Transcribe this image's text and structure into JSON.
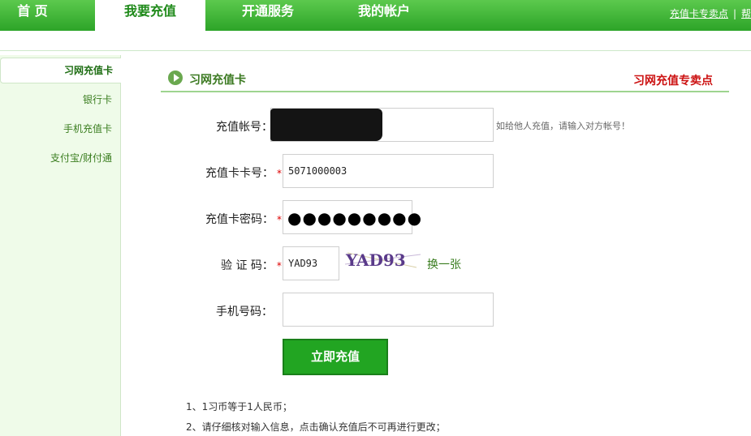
{
  "nav": {
    "items": [
      "首 页",
      "我要充值",
      "开通服务",
      "我的帐户"
    ],
    "links": {
      "sellers": "充值卡专卖点",
      "sep": "|",
      "help": "帮"
    }
  },
  "sidebar": {
    "items": [
      "习网充值卡",
      "银行卡",
      "手机充值卡",
      "支付宝/财付通"
    ]
  },
  "section": {
    "title": "习网充值卡",
    "link": "习网充值专卖点"
  },
  "form": {
    "account_label": "充值帐号：",
    "account_hint": "如给他人充值，请输入对方帐号！",
    "card_label": "充值卡卡号：",
    "card_value": "5071000003",
    "password_label": "充值卡密码：",
    "password_dots": "●●●●●●●●●",
    "captcha_label": "验 证 码：",
    "captcha_value": "YAD93",
    "captcha_image_text": "YAD93",
    "refresh_label": "换一张",
    "phone_label": "手机号码：",
    "phone_value": "",
    "required_mark": "*",
    "submit_label": "立即充值"
  },
  "notes": [
    "1、1习币等于1人民币；",
    "2、请仔细核对输入信息，点击确认充值后不可再进行更改；"
  ],
  "colors": {
    "nav_green": "#2fa62a",
    "accent_red": "#cc1111",
    "button_green": "#22a522"
  }
}
